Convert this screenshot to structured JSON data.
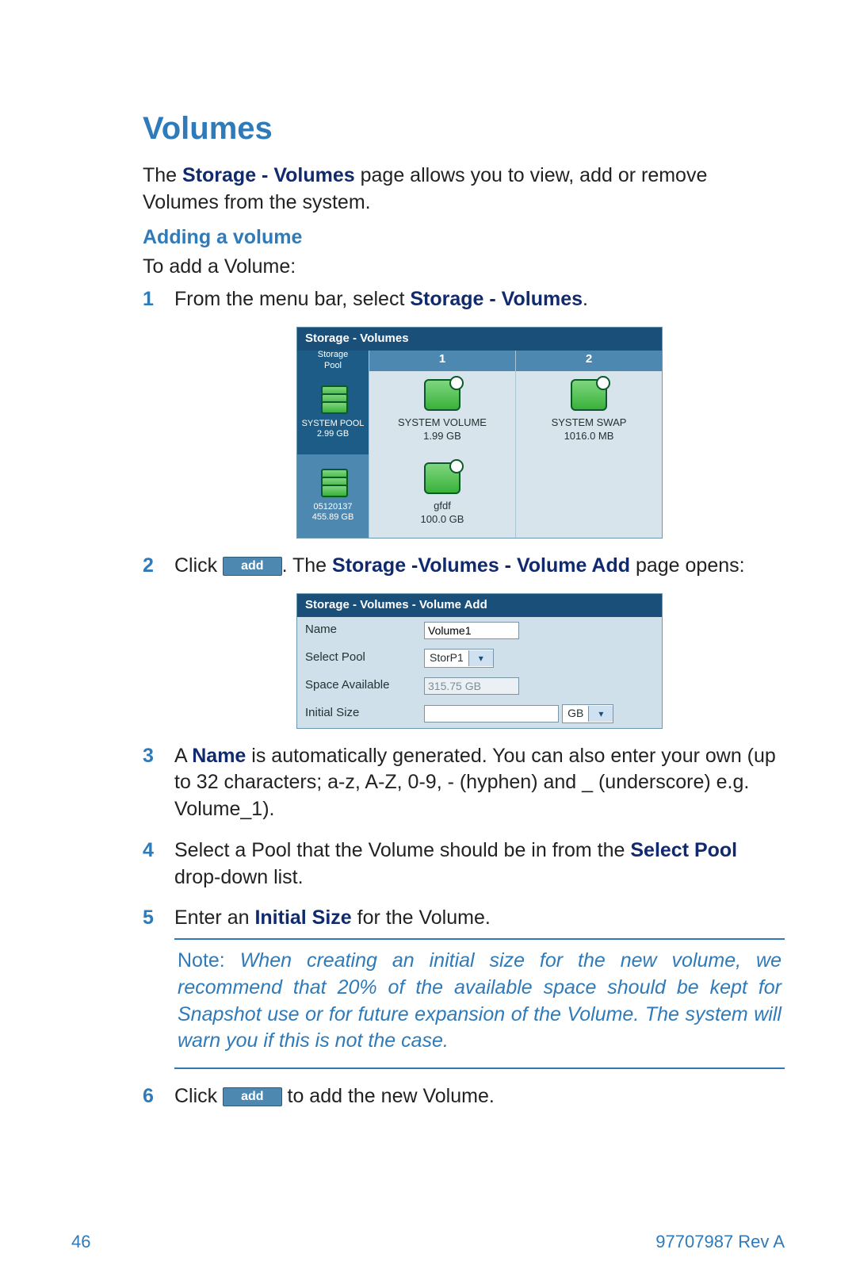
{
  "title": "Volumes",
  "lead_prefix": "The ",
  "lead_bold": "Storage - Volumes",
  "lead_suffix": " page allows you to view, add or remove Volumes from the system.",
  "sub": "Adding a volume",
  "intro": "To add a Volume:",
  "steps": {
    "n1": "1",
    "s1_a": "From the menu bar, select ",
    "s1_b": "Storage - Volumes",
    "s1_c": ".",
    "n2": "2",
    "s2_a": "Click ",
    "add_label": "add",
    "s2_b": ". The ",
    "s2_bold": "Storage -Volumes - Volume Add",
    "s2_c": " page opens:",
    "n3": "3",
    "s3_a": "A ",
    "s3_bold": "Name",
    "s3_b": " is automatically generated. You can also enter your own (up to 32 characters; a-z, A-Z, 0-9, - (hyphen) and _ (underscore) e.g. Volume_1).",
    "n4": "4",
    "s4_a": "Select a Pool that the Volume should be in from the ",
    "s4_bold": "Select Pool",
    "s4_b": " drop-down list.",
    "n5": "5",
    "s5_a": "Enter an ",
    "s5_bold": "Initial Size",
    "s5_b": " for the Volume.",
    "n6": "6",
    "s6_a": "Click ",
    "s6_b": " to add the new Volume."
  },
  "note": {
    "label": "Note:",
    "text": " When creating an initial size for the new volume, we recommend that 20% of the available space should be kept for Snapshot use or for future expansion of the Volume. The system will warn you if this is not the case."
  },
  "fig1": {
    "title": "Storage - Volumes",
    "side_label": "Storage\nPool",
    "col1": "1",
    "col2": "2",
    "pool1_name": "SYSTEM POOL",
    "pool1_size": "2.99 GB",
    "vol1_name": "SYSTEM VOLUME",
    "vol1_size": "1.99 GB",
    "vol2_name": "SYSTEM SWAP",
    "vol2_size": "1016.0 MB",
    "pool2_name": "05120137",
    "pool2_size": "455.89 GB",
    "vol3_name": "gfdf",
    "vol3_size": "100.0 GB"
  },
  "fig2": {
    "title": "Storage - Volumes - Volume Add",
    "name_label": "Name",
    "name_value": "Volume1",
    "pool_label": "Select Pool",
    "pool_value": "StorP1",
    "space_label": "Space Available",
    "space_value": "315.75 GB",
    "size_label": "Initial Size",
    "size_value": "",
    "unit": "GB"
  },
  "footer": {
    "page": "46",
    "doc": "97707987 Rev A"
  }
}
